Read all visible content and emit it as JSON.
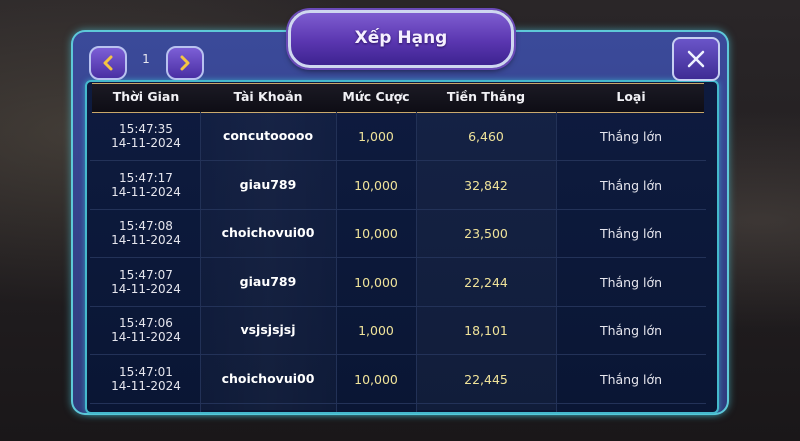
{
  "title": "Xếp Hạng",
  "pagination": {
    "page": "1"
  },
  "columns": [
    "Thời Gian",
    "Tài Khoản",
    "Mức Cược",
    "Tiền Thắng",
    "Loại"
  ],
  "rows": [
    {
      "time": "15:47:35",
      "date": "14-11-2024",
      "account": "concutooooo",
      "bet": "1,000",
      "win": "6,460",
      "type": "Thắng lớn"
    },
    {
      "time": "15:47:17",
      "date": "14-11-2024",
      "account": "giau789",
      "bet": "10,000",
      "win": "32,842",
      "type": "Thắng lớn"
    },
    {
      "time": "15:47:08",
      "date": "14-11-2024",
      "account": "choichovui00",
      "bet": "10,000",
      "win": "23,500",
      "type": "Thắng lớn"
    },
    {
      "time": "15:47:07",
      "date": "14-11-2024",
      "account": "giau789",
      "bet": "10,000",
      "win": "22,244",
      "type": "Thắng lớn"
    },
    {
      "time": "15:47:06",
      "date": "14-11-2024",
      "account": "vsjsjsjsj",
      "bet": "1,000",
      "win": "18,101",
      "type": "Thắng lớn"
    },
    {
      "time": "15:47:01",
      "date": "14-11-2024",
      "account": "choichovui00",
      "bet": "10,000",
      "win": "22,445",
      "type": "Thắng lớn"
    }
  ],
  "icons": {
    "prev": "chevron-left-icon",
    "next": "chevron-right-icon",
    "close": "close-icon"
  },
  "colors": {
    "panel": "#303c7d",
    "table": "#0e1b3f",
    "border": "#45b9cd",
    "gold": "#f0e39a",
    "header_line": "#c9a86a"
  }
}
